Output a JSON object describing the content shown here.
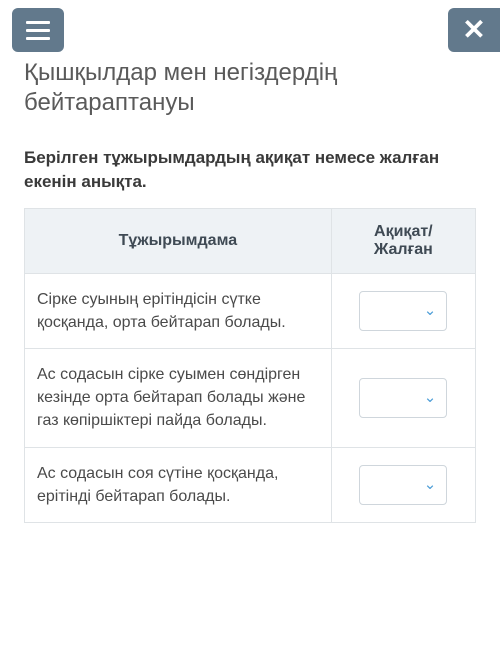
{
  "header": {
    "menu_icon": "hamburger-icon",
    "close_icon": "close-icon"
  },
  "title": "Қышқылдар мен негіздердің бейтараптануы",
  "instruction": "Берілген тұжырымдардың ақиқат немесе жалған екенін анықта.",
  "table": {
    "headers": {
      "statement": "Тұжырымдама",
      "answer": "Ақиқат/ Жалған"
    },
    "rows": [
      {
        "statement": "Сірке суының ерітіндісін сүтке қосқанда, орта бейтарап болады.",
        "answer": ""
      },
      {
        "statement": "Ас содасын сірке суымен сөндірген кезінде орта бейтарап болады және газ көпіршіктері пайда болады.",
        "answer": ""
      },
      {
        "statement": "Ас содасын соя сүтіне қосқанда, ерітінді бейтарап болады.",
        "answer": ""
      }
    ]
  }
}
